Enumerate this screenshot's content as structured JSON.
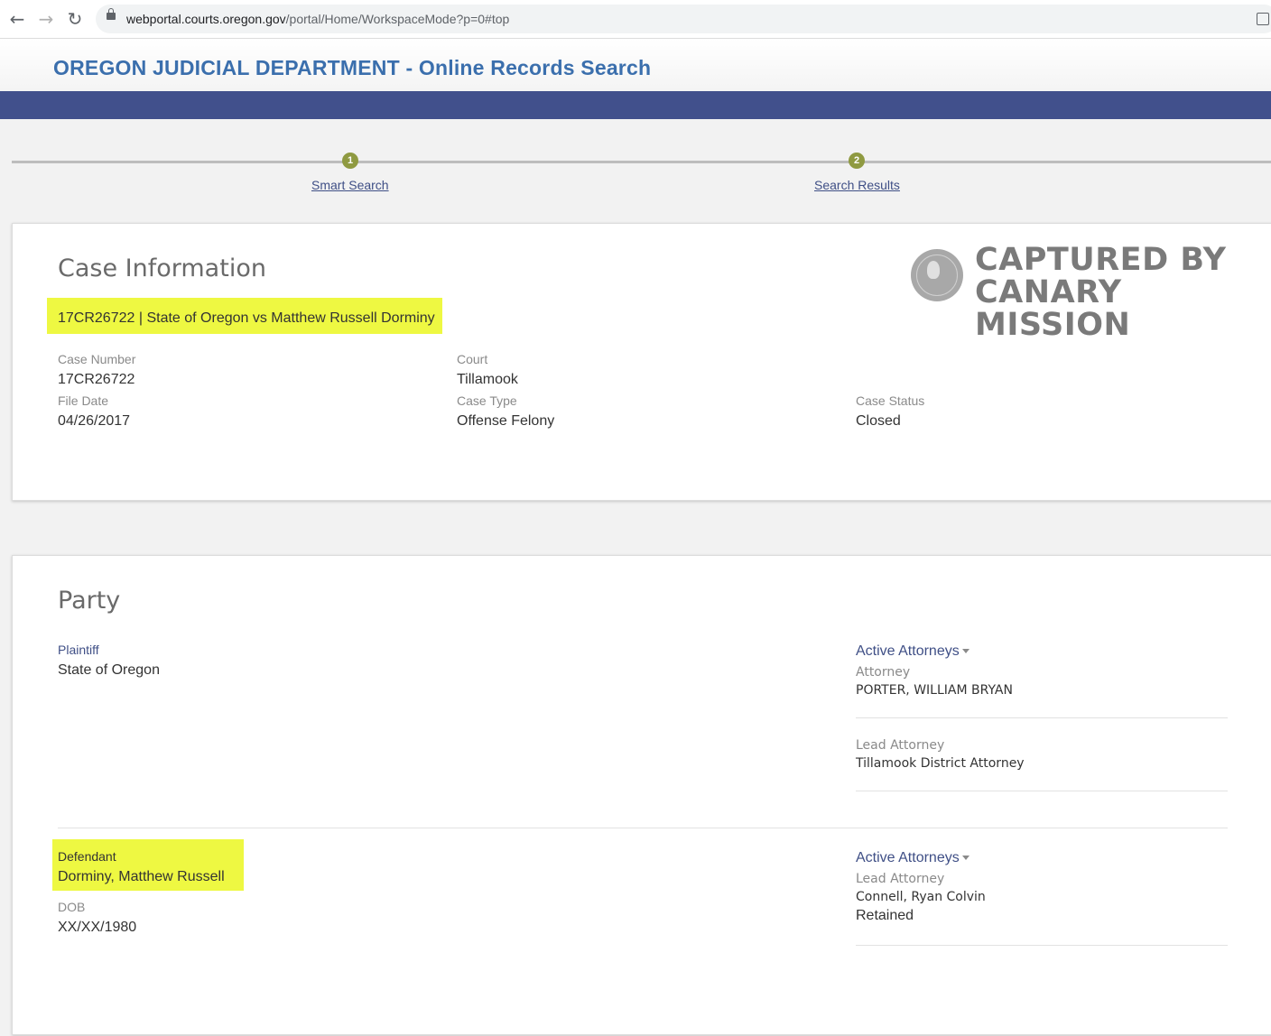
{
  "browser": {
    "url_domain": "webportal.courts.oregon.gov",
    "url_path": "/portal/Home/WorkspaceMode?p=0#top"
  },
  "header": {
    "title": "OREGON JUDICIAL DEPARTMENT - Online Records Search"
  },
  "steps": [
    {
      "number": "1",
      "label": "Smart Search"
    },
    {
      "number": "2",
      "label": "Search Results"
    }
  ],
  "case_info": {
    "title": "Case Information",
    "headline": "17CR26722 | State of Oregon vs Matthew Russell Dorminy",
    "case_number_label": "Case Number",
    "case_number": "17CR26722",
    "court_label": "Court",
    "court": "Tillamook",
    "file_date_label": "File Date",
    "file_date": "04/26/2017",
    "case_type_label": "Case Type",
    "case_type": "Offense Felony",
    "case_status_label": "Case Status",
    "case_status": "Closed"
  },
  "watermark": {
    "line1": "CAPTURED BY",
    "line2": "CANARY MISSION"
  },
  "party": {
    "title": "Party",
    "plaintiff": {
      "role": "Plaintiff",
      "name": "State of Oregon",
      "attorneys_label": "Active Attorneys",
      "attorney_label": "Attorney",
      "attorney": "PORTER, WILLIAM BRYAN",
      "lead_label": "Lead Attorney",
      "lead": "Tillamook District Attorney"
    },
    "defendant": {
      "role": "Defendant",
      "name": "Dorminy, Matthew Russell",
      "dob_label": "DOB",
      "dob": "XX/XX/1980",
      "attorneys_label": "Active Attorneys",
      "lead_label": "Lead Attorney",
      "lead": "Connell, Ryan Colvin",
      "lead_status": "Retained"
    }
  },
  "colors": {
    "highlight": "#eef842",
    "band": "#41508c",
    "link": "#3f4f86",
    "title": "#3b6fad",
    "step": "#8f9a41"
  }
}
